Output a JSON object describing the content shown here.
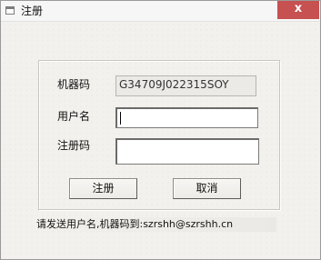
{
  "window": {
    "title": "注册",
    "close_glyph": "x"
  },
  "form": {
    "machine_code_label": "机器码",
    "machine_code_value": "G34709J022315SOY",
    "username_label": "用户名",
    "username_value": "",
    "regcode_label": "注册码",
    "regcode_value": ""
  },
  "buttons": {
    "register": "注册",
    "cancel": "取消"
  },
  "status": {
    "message": "请发送用户名,机器码到:szrshh@szrshh.cn"
  },
  "colors": {
    "close_button": "#c75050",
    "dialog_background": "#f3f1ed"
  }
}
